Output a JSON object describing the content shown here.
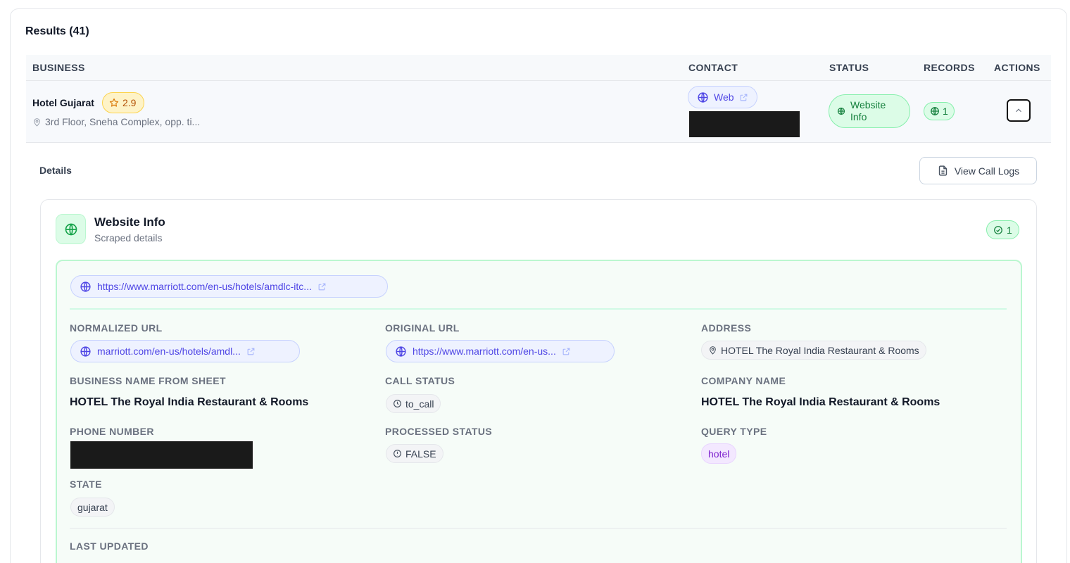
{
  "results": {
    "title": "Results (41)"
  },
  "table": {
    "headers": {
      "business": "BUSINESS",
      "contact": "CONTACT",
      "status": "STATUS",
      "records": "RECORDS",
      "actions": "ACTIONS"
    },
    "row": {
      "name": "Hotel Gujarat",
      "rating": "2.9",
      "address": "3rd Floor, Sneha Complex, opp. ti...",
      "contact_web": "Web",
      "status_line1": "Website",
      "status_line2": "Info",
      "records": "1"
    }
  },
  "details": {
    "label": "Details",
    "view_call_logs": "View Call Logs",
    "panel": {
      "title": "Website Info",
      "subtitle": "Scraped details",
      "count": "1",
      "main_url": "https://www.marriott.com/en-us/hotels/amdlc-itc...",
      "fields": {
        "normalized_url": {
          "label": "NORMALIZED URL",
          "value": "marriott.com/en-us/hotels/amdl..."
        },
        "original_url": {
          "label": "ORIGINAL URL",
          "value": "https://www.marriott.com/en-us..."
        },
        "address": {
          "label": "ADDRESS",
          "value": "HOTEL The Royal India Restaurant & Rooms"
        },
        "business_name": {
          "label": "BUSINESS NAME FROM SHEET",
          "value": "HOTEL The Royal India Restaurant & Rooms"
        },
        "call_status": {
          "label": "CALL STATUS",
          "value": "to_call"
        },
        "company_name": {
          "label": "COMPANY NAME",
          "value": "HOTEL The Royal India Restaurant & Rooms"
        },
        "phone_number": {
          "label": "PHONE NUMBER",
          "value": ""
        },
        "processed_status": {
          "label": "PROCESSED STATUS",
          "value": "FALSE"
        },
        "query_type": {
          "label": "QUERY TYPE",
          "value": "hotel"
        },
        "state": {
          "label": "STATE",
          "value": "gujarat"
        },
        "last_updated": {
          "label": "LAST UPDATED",
          "value": ""
        }
      }
    }
  },
  "colors": {
    "accent": "#4f46e5",
    "success": "#15803d",
    "warning": "#b45309",
    "query": "#7e22ce"
  }
}
